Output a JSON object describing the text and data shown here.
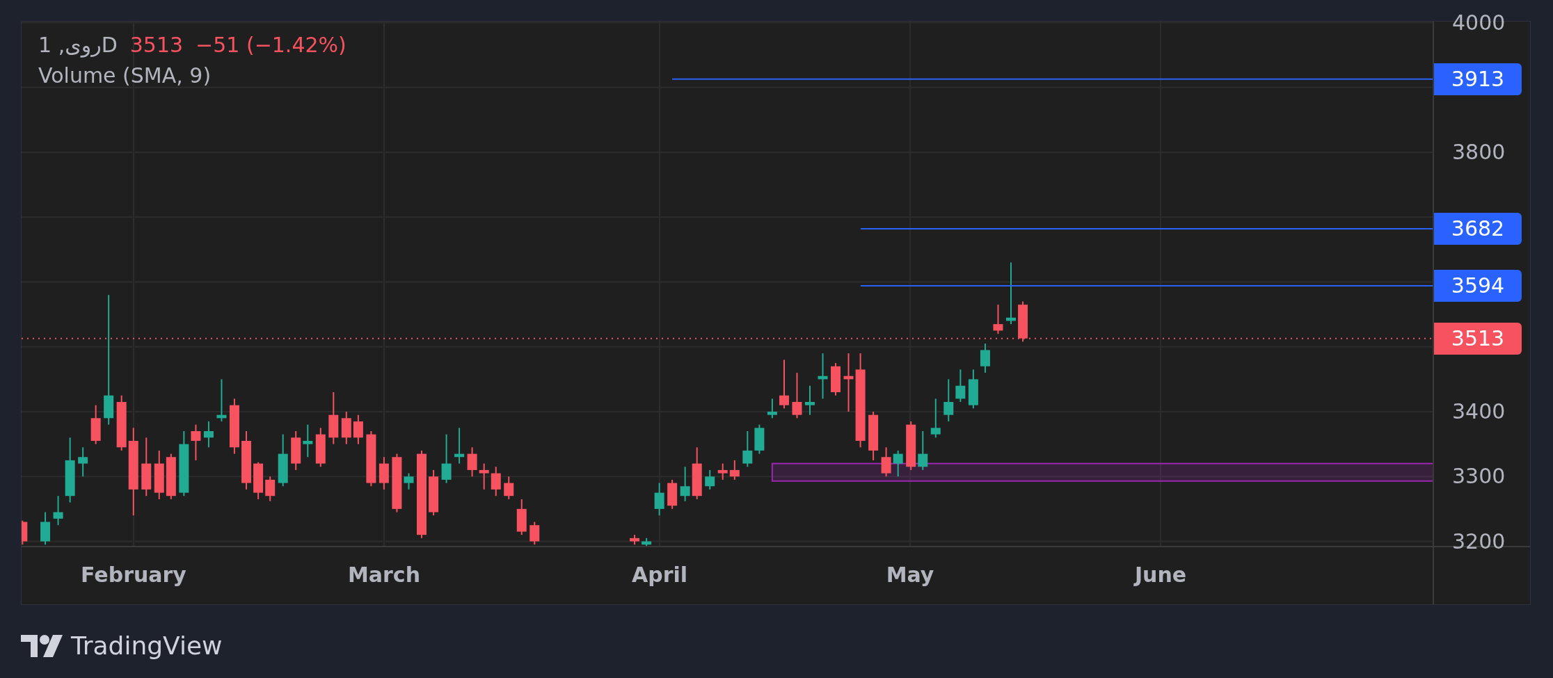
{
  "legend": {
    "symbol": "Dروی, 1",
    "price": "3513",
    "change": "−51 (−1.42%)",
    "indicator": "Volume (SMA, 9)"
  },
  "chart": {
    "price_ticks": [
      "4000",
      "3800",
      "3400",
      "3300",
      "3200"
    ],
    "months": [
      "February",
      "March",
      "April",
      "May",
      "June"
    ],
    "price_lines": [
      {
        "label": "3913",
        "kind": "level"
      },
      {
        "label": "3682",
        "kind": "level"
      },
      {
        "label": "3594",
        "kind": "level"
      },
      {
        "label": "3513",
        "kind": "last"
      }
    ]
  },
  "footer": {
    "brand": "TradingView"
  }
}
